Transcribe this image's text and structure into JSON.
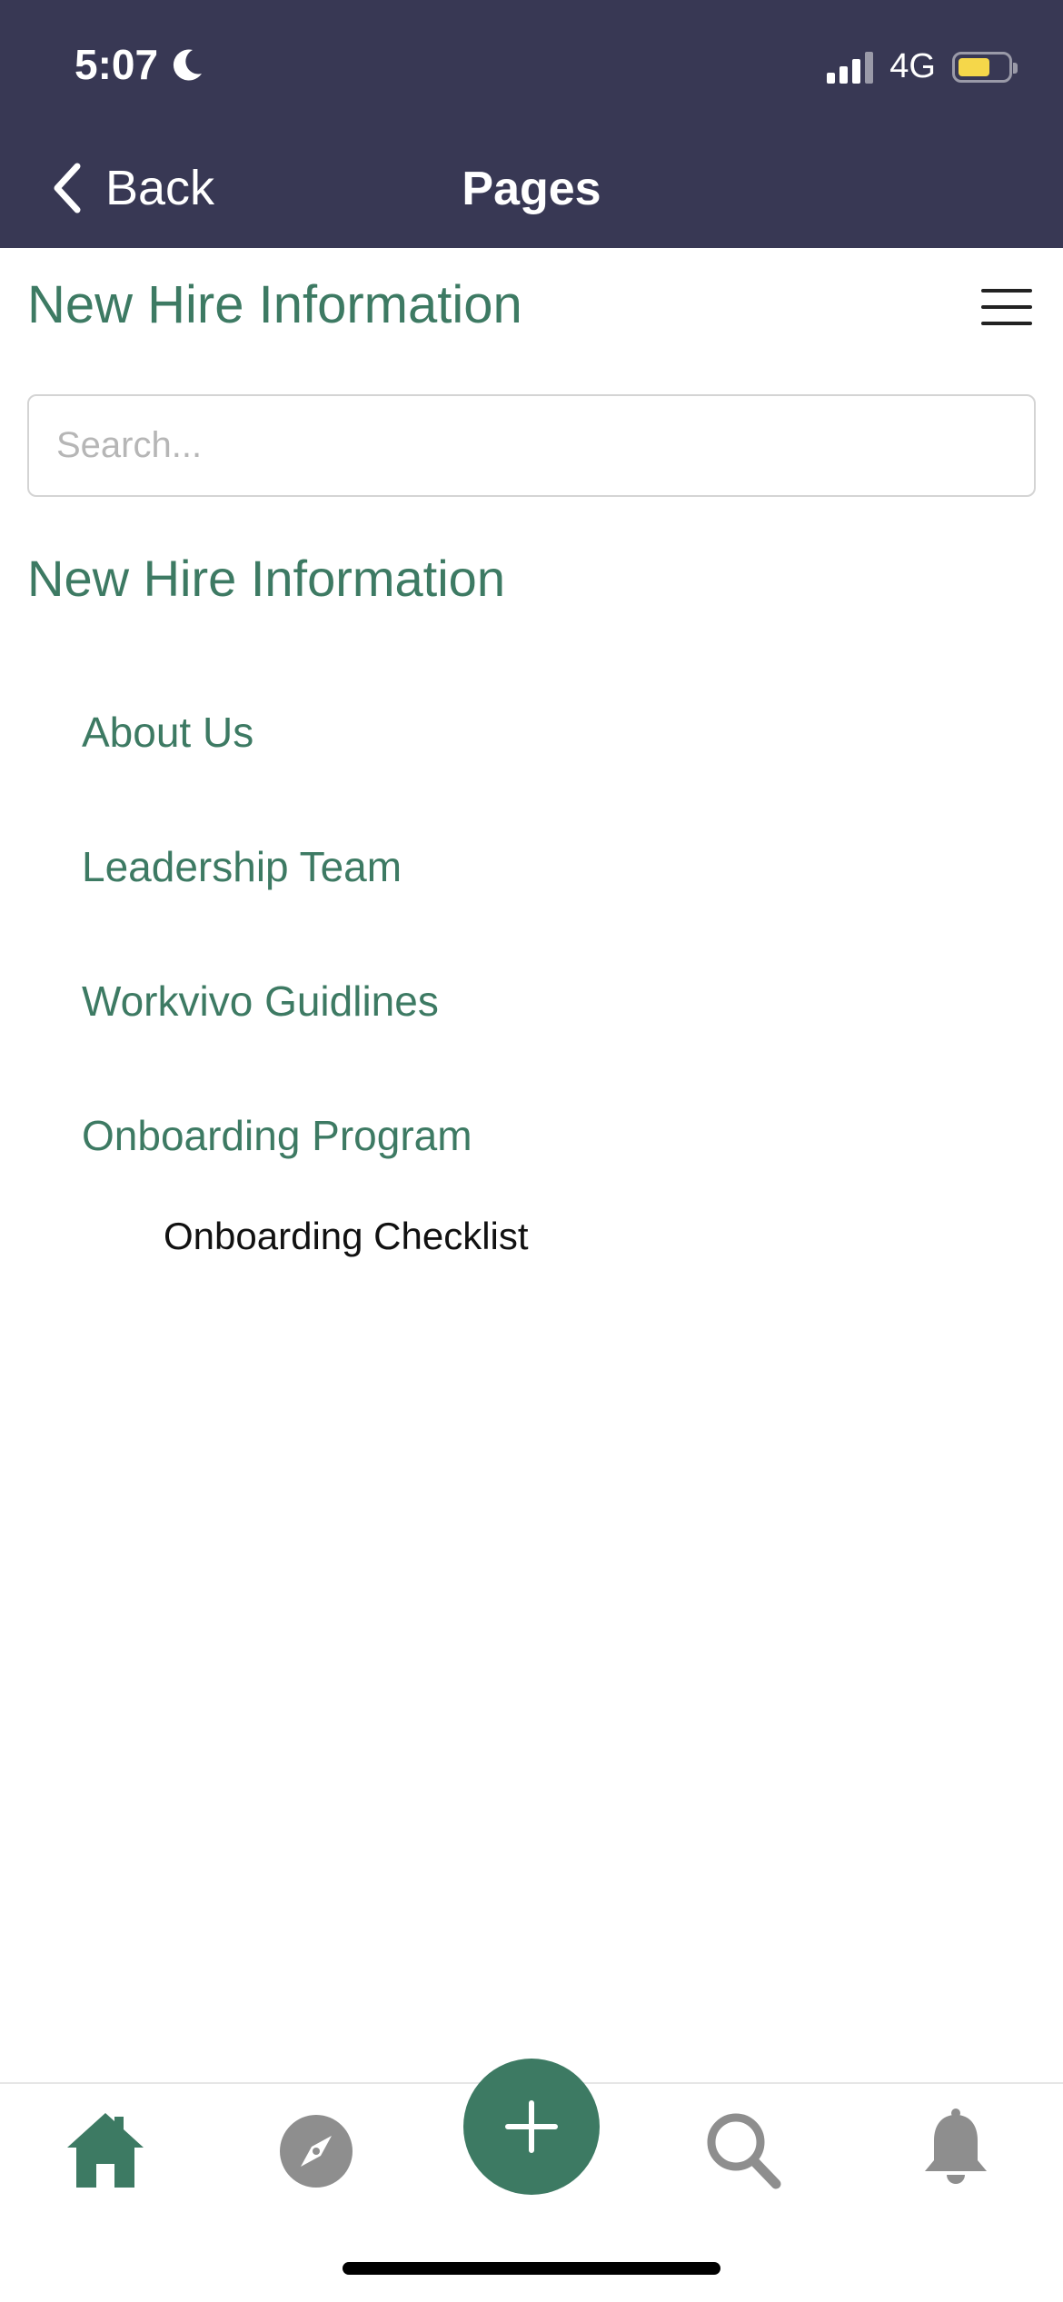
{
  "status_bar": {
    "time": "5:07",
    "network": "4G"
  },
  "nav": {
    "back_label": "Back",
    "title": "Pages"
  },
  "page": {
    "title": "New Hire Information"
  },
  "search": {
    "placeholder": "Search..."
  },
  "section": {
    "title": "New Hire Information",
    "items": [
      {
        "label": "About Us"
      },
      {
        "label": "Leadership Team"
      },
      {
        "label": "Workvivo Guidlines"
      },
      {
        "label": "Onboarding Program"
      }
    ],
    "subitems": [
      {
        "label": "Onboarding Checklist"
      }
    ]
  },
  "tabbar": {
    "tabs": [
      {
        "icon": "home-icon",
        "active": true
      },
      {
        "icon": "compass-icon",
        "active": false
      },
      {
        "icon": "plus-icon",
        "active": false
      },
      {
        "icon": "search-icon",
        "active": false
      },
      {
        "icon": "bell-icon",
        "active": false
      }
    ]
  },
  "colors": {
    "header_bg": "#383854",
    "accent": "#3d7a63",
    "inactive_icon": "#8e8e8e",
    "battery": "#f5d74a"
  }
}
